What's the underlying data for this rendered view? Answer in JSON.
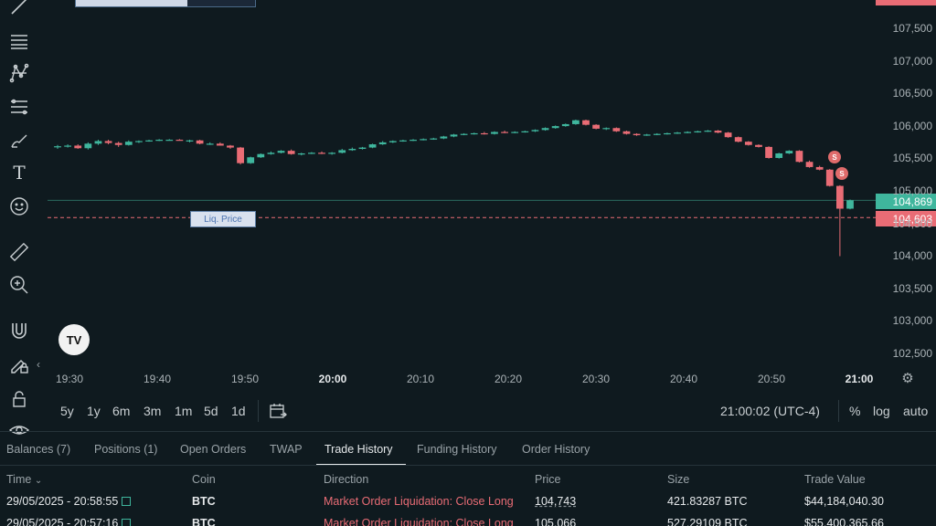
{
  "toolbar": {
    "icons": [
      "trend-line-icon",
      "horizontal-lines-icon",
      "pattern-icon",
      "fib-retracement-icon",
      "brush-icon",
      "text-icon",
      "emoji-icon",
      "ruler-icon",
      "zoom-in-icon",
      "magnet-icon",
      "lock-drawing-icon",
      "lock-icon",
      "eye-icon"
    ],
    "text_tool_glyph": "T"
  },
  "chart": {
    "liq_label": "Liq. Price",
    "current_price": "104,869",
    "liq_price": "104,603",
    "y_labels": [
      "107,500",
      "107,000",
      "106,500",
      "106,000",
      "105,500",
      "105,000",
      "104,500",
      "104,000",
      "103,500",
      "103,000",
      "102,500"
    ],
    "x_labels": [
      "19:30",
      "19:40",
      "19:50",
      "20:00",
      "20:10",
      "20:20",
      "20:30",
      "20:40",
      "20:50",
      "21:00"
    ],
    "bold_x_labels": [
      "20:00",
      "21:00"
    ],
    "sell_marker": "S",
    "tv_logo": "TV",
    "colors": {
      "up": "#3fb69d",
      "down": "#e96c75",
      "liq_line": "#e96c75"
    }
  },
  "chart_data": {
    "type": "candlestick",
    "y_range": [
      102300,
      107800
    ],
    "candles": [
      [
        105690,
        105720,
        105660,
        105700
      ],
      [
        105700,
        105730,
        105680,
        105710
      ],
      [
        105710,
        105730,
        105660,
        105670
      ],
      [
        105670,
        105760,
        105650,
        105740
      ],
      [
        105740,
        105800,
        105720,
        105780
      ],
      [
        105780,
        105800,
        105730,
        105750
      ],
      [
        105750,
        105770,
        105690,
        105720
      ],
      [
        105720,
        105790,
        105710,
        105770
      ],
      [
        105770,
        105790,
        105750,
        105780
      ],
      [
        105780,
        105800,
        105770,
        105790
      ],
      [
        105790,
        105810,
        105780,
        105800
      ],
      [
        105800,
        105810,
        105790,
        105800
      ],
      [
        105800,
        105810,
        105790,
        105790
      ],
      [
        105790,
        105800,
        105760,
        105790
      ],
      [
        105790,
        105800,
        105730,
        105740
      ],
      [
        105740,
        105760,
        105720,
        105740
      ],
      [
        105740,
        105760,
        105710,
        105710
      ],
      [
        105710,
        105720,
        105660,
        105680
      ],
      [
        105680,
        105690,
        105420,
        105440
      ],
      [
        105440,
        105540,
        105430,
        105530
      ],
      [
        105530,
        105590,
        105520,
        105580
      ],
      [
        105580,
        105620,
        105570,
        105600
      ],
      [
        105600,
        105640,
        105590,
        105630
      ],
      [
        105630,
        105650,
        105570,
        105580
      ],
      [
        105580,
        105600,
        105560,
        105590
      ],
      [
        105590,
        105610,
        105580,
        105600
      ],
      [
        105600,
        105620,
        105580,
        105590
      ],
      [
        105590,
        105610,
        105570,
        105600
      ],
      [
        105600,
        105660,
        105590,
        105640
      ],
      [
        105640,
        105680,
        105630,
        105660
      ],
      [
        105660,
        105690,
        105650,
        105680
      ],
      [
        105680,
        105740,
        105670,
        105730
      ],
      [
        105730,
        105780,
        105720,
        105760
      ],
      [
        105760,
        105790,
        105750,
        105780
      ],
      [
        105780,
        105800,
        105770,
        105790
      ],
      [
        105790,
        105810,
        105780,
        105800
      ],
      [
        105800,
        105820,
        105790,
        105810
      ],
      [
        105810,
        105830,
        105800,
        105820
      ],
      [
        105820,
        105860,
        105810,
        105850
      ],
      [
        105850,
        105890,
        105840,
        105880
      ],
      [
        105880,
        105900,
        105870,
        105890
      ],
      [
        105890,
        105910,
        105880,
        105900
      ],
      [
        105900,
        105920,
        105880,
        105890
      ],
      [
        105890,
        105930,
        105880,
        105920
      ],
      [
        105920,
        105940,
        105900,
        105910
      ],
      [
        105910,
        105930,
        105900,
        105920
      ],
      [
        105920,
        105940,
        105910,
        105930
      ],
      [
        105930,
        105960,
        105920,
        105950
      ],
      [
        105950,
        105990,
        105940,
        105980
      ],
      [
        105980,
        106020,
        105970,
        106010
      ],
      [
        106010,
        106050,
        106000,
        106040
      ],
      [
        106040,
        106110,
        106030,
        106100
      ],
      [
        106100,
        106110,
        106020,
        106030
      ],
      [
        106030,
        106040,
        105960,
        105970
      ],
      [
        105970,
        105990,
        105950,
        105980
      ],
      [
        105980,
        105990,
        105920,
        105930
      ],
      [
        105930,
        105940,
        105880,
        105890
      ],
      [
        105890,
        105900,
        105860,
        105870
      ],
      [
        105870,
        105890,
        105860,
        105880
      ],
      [
        105880,
        105900,
        105870,
        105890
      ],
      [
        105890,
        105910,
        105880,
        105900
      ],
      [
        105900,
        105920,
        105890,
        105910
      ],
      [
        105910,
        105930,
        105900,
        105920
      ],
      [
        105920,
        105940,
        105910,
        105930
      ],
      [
        105930,
        105950,
        105920,
        105940
      ],
      [
        105940,
        105950,
        105900,
        105910
      ],
      [
        105910,
        105920,
        105830,
        105840
      ],
      [
        105840,
        105850,
        105760,
        105770
      ],
      [
        105770,
        105780,
        105710,
        105720
      ],
      [
        105720,
        105730,
        105680,
        105690
      ],
      [
        105690,
        105700,
        105510,
        105520
      ],
      [
        105520,
        105600,
        105510,
        105590
      ],
      [
        105590,
        105640,
        105580,
        105630
      ],
      [
        105630,
        105640,
        105450,
        105460
      ],
      [
        105460,
        105480,
        105370,
        105380
      ],
      [
        105380,
        105400,
        105330,
        105340
      ],
      [
        105340,
        105350,
        105080,
        105090
      ],
      [
        105090,
        105100,
        104010,
        104740
      ],
      [
        104740,
        104880,
        104730,
        104869
      ]
    ],
    "current_price": 104869,
    "liquidation_price": 104603
  },
  "range_bar": {
    "ranges": [
      "5y",
      "1y",
      "6m",
      "3m",
      "1m",
      "5d",
      "1d"
    ],
    "clock": "21:00:02 (UTC-4)",
    "percent": "%",
    "log": "log",
    "auto": "auto"
  },
  "tabs": [
    "Balances (7)",
    "Positions (1)",
    "Open Orders",
    "TWAP",
    "Trade History",
    "Funding History",
    "Order History"
  ],
  "active_tab": "Trade History",
  "table": {
    "headers": {
      "time": "Time",
      "coin": "Coin",
      "direction": "Direction",
      "price": "Price",
      "size": "Size",
      "value": "Trade Value"
    },
    "rows": [
      {
        "time": "29/05/2025 - 20:58:55",
        "coin": "BTC",
        "direction": "Market Order Liquidation: Close Long",
        "price": "104,743",
        "size": "421.83287 BTC",
        "value": "$44,184,040.30"
      },
      {
        "time": "29/05/2025 - 20:57:16",
        "coin": "BTC",
        "direction": "Market Order Liquidation: Close Long",
        "price": "105,066",
        "size": "527.29109 BTC",
        "value": "$55,400,365.66"
      }
    ]
  }
}
